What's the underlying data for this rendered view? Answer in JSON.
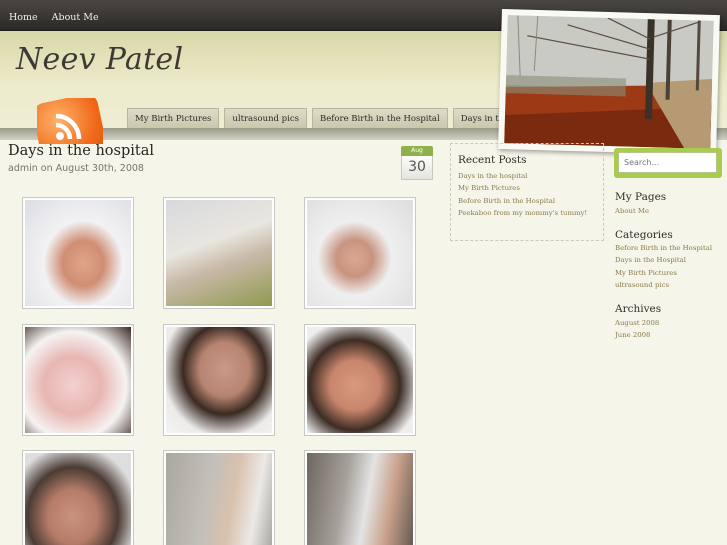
{
  "nav": {
    "home": "Home",
    "about": "About Me"
  },
  "site": {
    "title": "Neev Patel"
  },
  "category_tabs": [
    "My Birth Pictures",
    "ultrasound pics",
    "Before Birth in the Hospital",
    "Days in the Hospital"
  ],
  "search": {
    "placeholder": "Search..."
  },
  "post": {
    "title": "Days in the hospital",
    "meta": "admin on August 30th, 2008",
    "date_month": "Aug",
    "date_day": "30"
  },
  "recent_posts": {
    "heading": "Recent Posts",
    "items": [
      "Days in the hospital",
      "My Birth Pictures",
      "Before Birth in the Hospital",
      "Peekaboo from my mommy's tummy!"
    ]
  },
  "sidebar": {
    "pages_heading": "My Pages",
    "pages": [
      "About Me"
    ],
    "categories_heading": "Categories",
    "categories": [
      "Before Birth in the Hospital",
      "Days in the Hospital",
      "My Birth Pictures",
      "ultrasound pics"
    ],
    "archives_heading": "Archives",
    "archives": [
      "August 2008",
      "June 2008"
    ]
  },
  "colors": {
    "accent_green": "#a9cc4c",
    "link_color": "#8a7a4a",
    "rss_orange": "#f16a1a"
  },
  "icons": {
    "rss": "rss-feed-icon"
  }
}
